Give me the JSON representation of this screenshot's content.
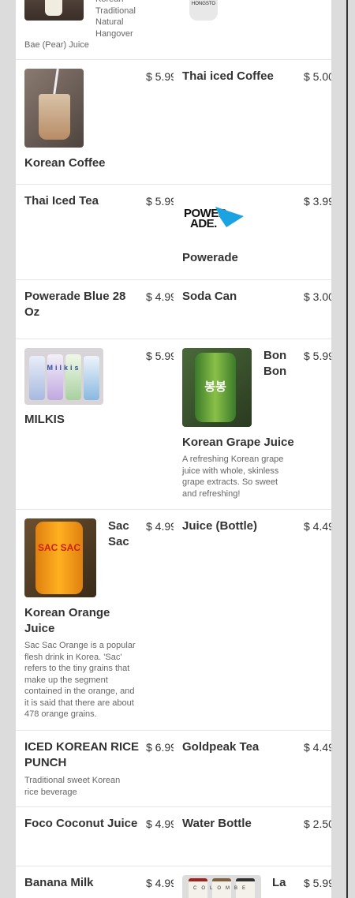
{
  "items": {
    "top_left": {
      "name": "Bae (Pear) Juice",
      "desc": "Korean Traditional Natural Hangover"
    },
    "top_right": {
      "can_text": "HONGSTO"
    },
    "korean_coffee": {
      "name": "Korean Coffee",
      "price": "$ 5.99"
    },
    "thai_iced_coffee": {
      "name": "Thai iced Coffee",
      "price": "$ 5.00"
    },
    "thai_iced_tea": {
      "name": "Thai Iced Tea",
      "price": "$ 5.99"
    },
    "powerade": {
      "name": "Powerade",
      "price": "$ 3.99",
      "logo_line1": "POWER",
      "logo_line2": "ADE."
    },
    "powerade_blue": {
      "name": "Powerade Blue 28 Oz",
      "price": "$ 4.99"
    },
    "soda_can": {
      "name": "Soda Can",
      "price": "$ 3.00"
    },
    "milkis": {
      "name": "MILKIS",
      "price": "$ 5.99",
      "can_text": "Milkis"
    },
    "bon_bon": {
      "name_side": "Bon Bon",
      "name": "Korean Grape Juice",
      "price": "$ 5.99",
      "desc": "A refreshing Korean grape juice with whole, skinless grape extracts. So sweet and refreshing!",
      "can_text": "봉봉"
    },
    "sac_sac": {
      "name_side": "Sac Sac",
      "name": "Korean Orange Juice",
      "price": "$ 4.99",
      "desc": "Sac Sac Orange is a popular flesh drink in Korea. 'Sac' refers to the tiny grains that make up the segment contained in the orange, and it is said that there are about 478 orange grains.",
      "can_text": "SAC SAC"
    },
    "juice_bottle": {
      "name": "Juice (Bottle)",
      "price": "$ 4.49"
    },
    "rice_punch": {
      "name": "ICED KOREAN RICE PUNCH",
      "price": "$ 6.99",
      "desc": "Traditional sweet Korean rice beverage"
    },
    "goldpeak": {
      "name": "Goldpeak Tea",
      "price": "$ 4.49"
    },
    "foco": {
      "name": "Foco Coconut Juice",
      "price": "$ 4.99"
    },
    "water": {
      "name": "Water Bottle",
      "price": "$ 2.50"
    },
    "banana_milk": {
      "name": "Banana Milk",
      "price": "$ 4.99"
    },
    "la_colombe": {
      "name_side": "La",
      "price": "$ 5.99",
      "can_text": "COLOMBE"
    }
  }
}
